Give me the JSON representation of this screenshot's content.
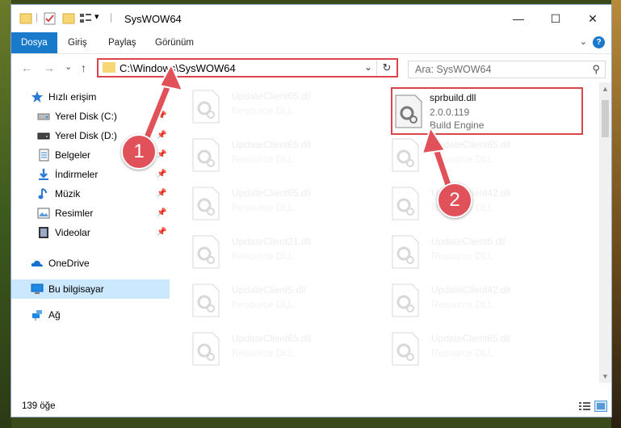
{
  "window": {
    "title": "SysWOW64",
    "min_glyph": "—",
    "max_glyph": "☐",
    "close_glyph": "✕",
    "qa_dropdown_glyph": "▾"
  },
  "ribbon": {
    "tabs": [
      {
        "label": "Dosya",
        "active": true
      },
      {
        "label": "Giriş"
      },
      {
        "label": "Paylaş"
      },
      {
        "label": "Görünüm"
      }
    ],
    "expand_glyph": "⌄",
    "help_glyph": "?"
  },
  "nav": {
    "back_glyph": "←",
    "forward_glyph": "→",
    "recent_glyph": "⌄",
    "up_glyph": "↑",
    "address": "C:\\Windows\\SysWOW64",
    "address_dropdown_glyph": "⌄",
    "refresh_glyph": "↻",
    "search_placeholder": "Ara: SysWOW64",
    "search_glyph": "⚲"
  },
  "sidebar": {
    "pin_glyph": "📌",
    "items": [
      {
        "label": "Hızlı erişim",
        "icon": "star-icon"
      },
      {
        "label": "Yerel Disk (C:)",
        "icon": "drive-icon",
        "pinned": true
      },
      {
        "label": "Yerel Disk (D:)",
        "icon": "drive-icon",
        "pinned": true
      },
      {
        "label": "Belgeler",
        "icon": "documents-icon",
        "pinned": true
      },
      {
        "label": "İndirmeler",
        "icon": "download-icon",
        "pinned": true
      },
      {
        "label": "Müzik",
        "icon": "music-icon",
        "pinned": true
      },
      {
        "label": "Resimler",
        "icon": "pictures-icon",
        "pinned": true
      },
      {
        "label": "Videolar",
        "icon": "video-icon",
        "pinned": true
      },
      {
        "label": "OneDrive",
        "icon": "cloud-icon"
      },
      {
        "label": "Bu bilgisayar",
        "icon": "computer-icon",
        "selected": true
      },
      {
        "label": "Ağ",
        "icon": "network-icon"
      }
    ]
  },
  "files": {
    "left_column": [
      {
        "name": "UpdateClient65.dll",
        "type": "Resource DLL"
      },
      {
        "name": "UpdateClient65.dll",
        "type": "Resource DLL"
      },
      {
        "name": "UpdateClient65.dll",
        "type": "Resource DLL"
      },
      {
        "name": "UpdateClient21.dll",
        "type": "Resource DLL"
      },
      {
        "name": "UpdateClient5.dll",
        "type": "Resource DLL"
      },
      {
        "name": "UpdateClient65.dll",
        "type": "Resource DLL"
      }
    ],
    "highlighted": {
      "name": "sprbuild.dll",
      "version": "2.0.0.119",
      "type": "Build Engine"
    },
    "right_column": [
      {
        "name": "UpdateClient65.dll",
        "type": "Resource DLL"
      },
      {
        "name": "UpdateClient42.dll",
        "type": "Resource DLL"
      },
      {
        "name": "UpdateClient5.dll",
        "type": "Resource DLL"
      },
      {
        "name": "UpdateClient42.dll",
        "type": "Resource DLL"
      },
      {
        "name": "UpdateClient65.dll",
        "type": "Resource DLL"
      }
    ]
  },
  "status": {
    "item_count": "139 öğe"
  },
  "annotations": {
    "step1": "1",
    "step2": "2",
    "color": "#e0515a"
  }
}
